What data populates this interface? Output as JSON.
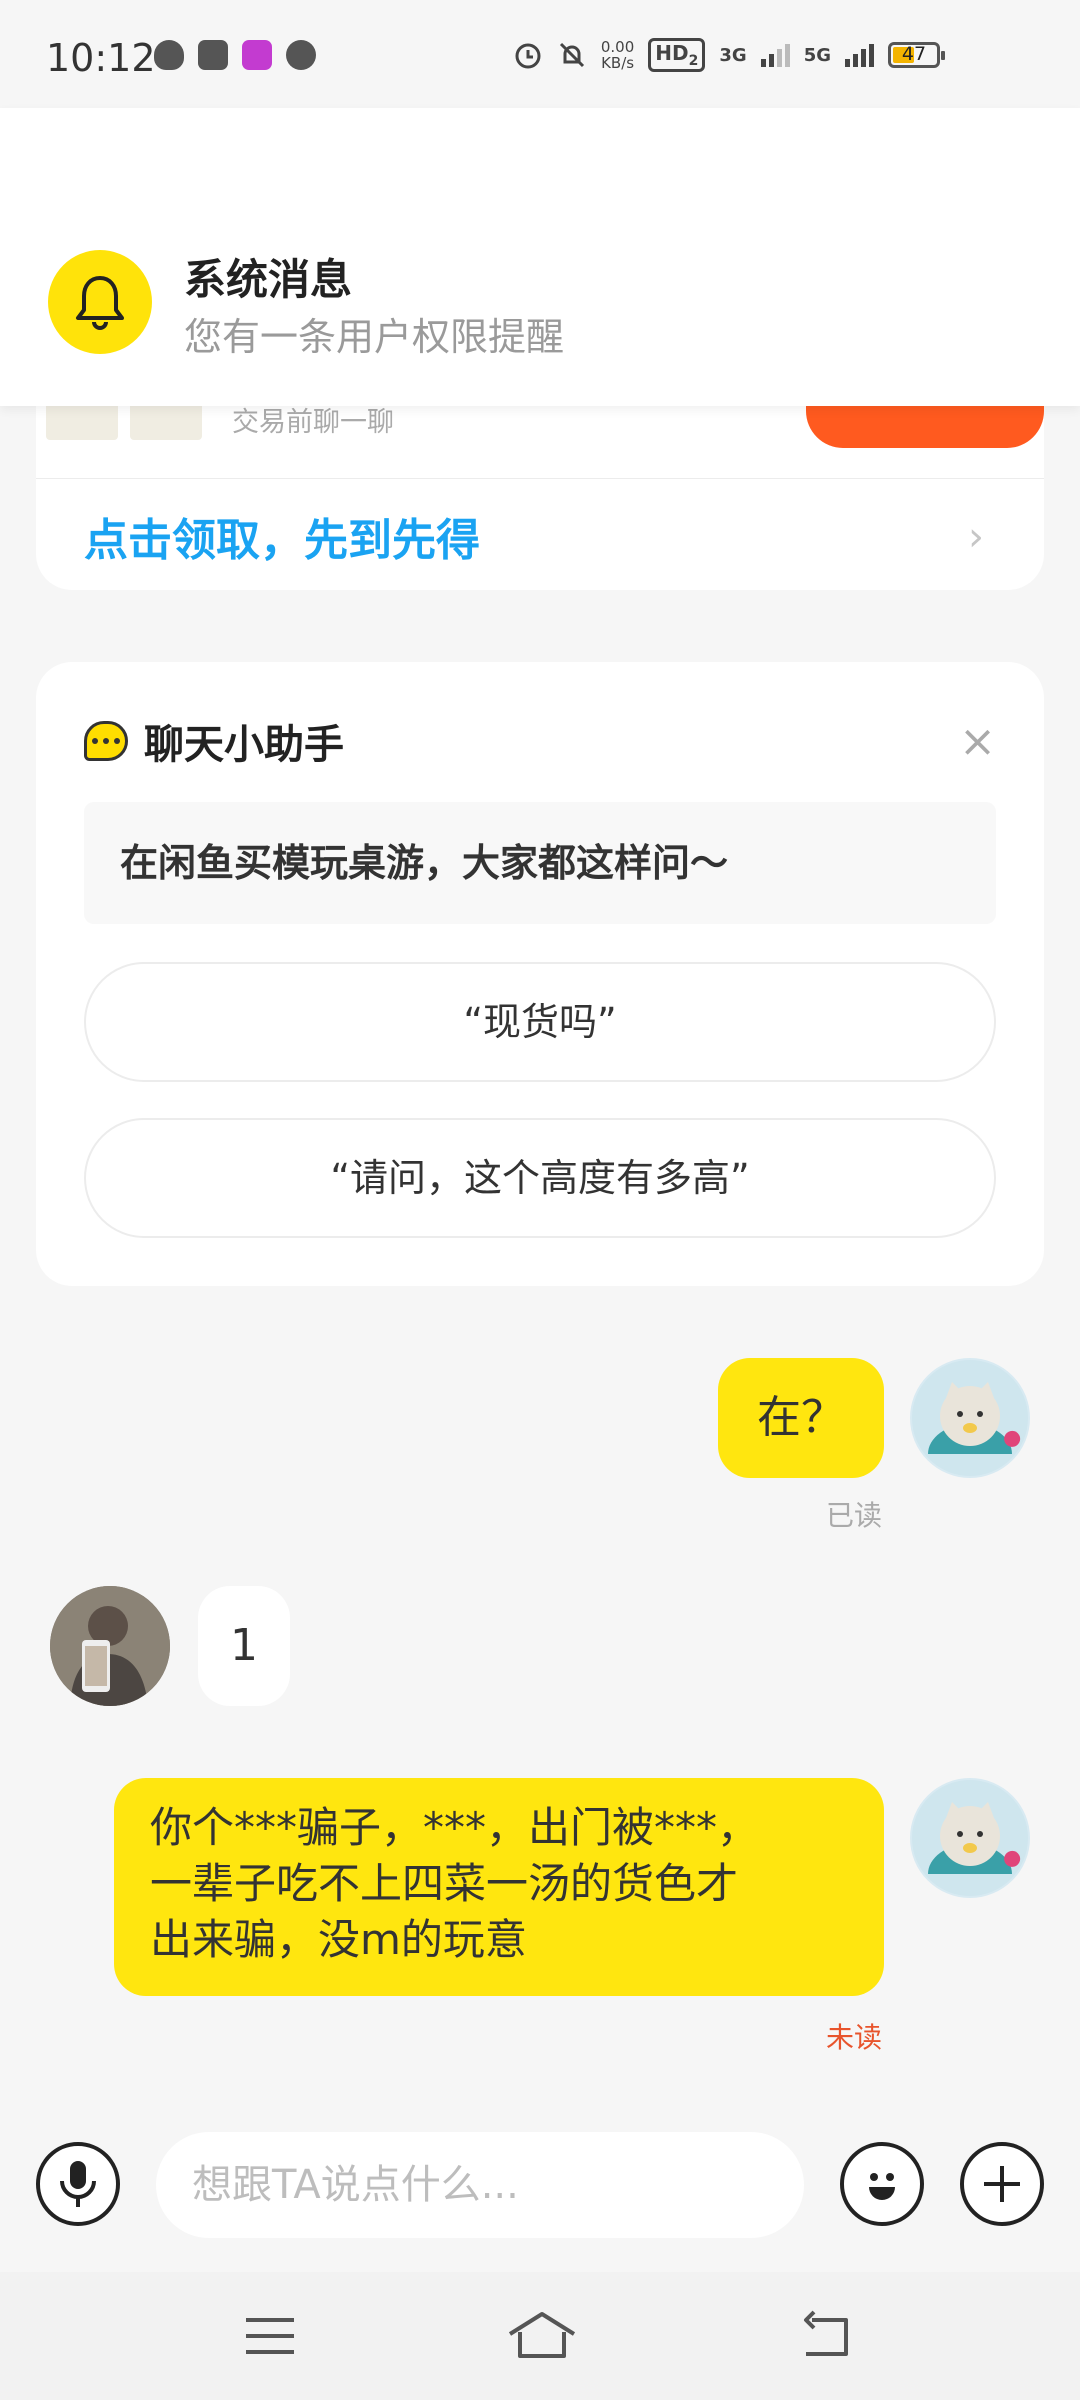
{
  "status_bar": {
    "time": "10:12",
    "net_speed_value": "0.00",
    "net_speed_unit": "KB/s",
    "hd": "HD",
    "hd_sub": "2",
    "net1": "3G",
    "net2": "5G",
    "battery": "47"
  },
  "notification": {
    "title": "系统消息",
    "subtitle": "您有一条用户权限提醒",
    "icon": "bell-icon"
  },
  "top_card": {
    "subtitle": "交易前聊一聊",
    "coupon_link": "点击领取，先到先得"
  },
  "helper": {
    "title": "聊天小助手",
    "close": "×",
    "prompt": "在闲鱼买模玩桌游，大家都这样问～",
    "suggestions": [
      "“现货吗”",
      "“请问，这个高度有多高”"
    ]
  },
  "messages": [
    {
      "side": "right",
      "text": "在？",
      "status": "已读"
    },
    {
      "side": "left",
      "text": "1"
    },
    {
      "side": "right",
      "lines": [
        "你个***骗子，***，出门被***，",
        "一辈子吃不上四菜一汤的货色才",
        "出来骗，没m的玩意"
      ],
      "status": "未读"
    }
  ],
  "composer": {
    "placeholder": "想跟TA说点什么..."
  },
  "colors": {
    "accent_yellow": "#ffe60f",
    "link_blue": "#1aa3f2",
    "buy_orange": "#ff5a1f",
    "unread_red": "#e8542c"
  }
}
